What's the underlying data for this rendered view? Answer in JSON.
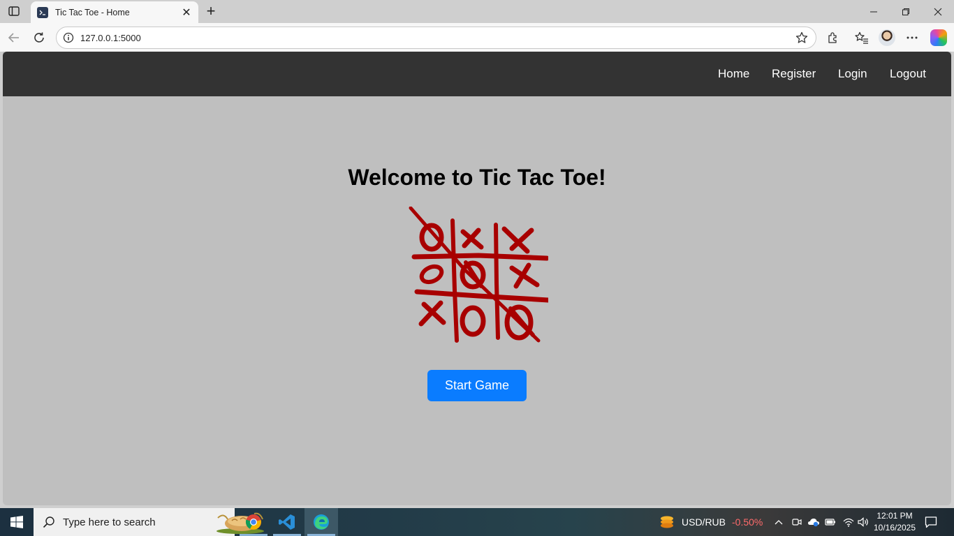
{
  "browser": {
    "tab_title": "Tic Tac Toe - Home",
    "url": "127.0.0.1:5000"
  },
  "site": {
    "nav": [
      "Home",
      "Register",
      "Login",
      "Logout"
    ],
    "heading": "Welcome to Tic Tac Toe!",
    "start_button": "Start Game",
    "accent_color": "#0a7cff",
    "board_color": "#a80000"
  },
  "taskbar": {
    "search_placeholder": "Type here to search",
    "ticker_label": "USD/RUB",
    "ticker_change": "-0.50%",
    "time": "12:01 PM",
    "date": "10/16/2025"
  }
}
